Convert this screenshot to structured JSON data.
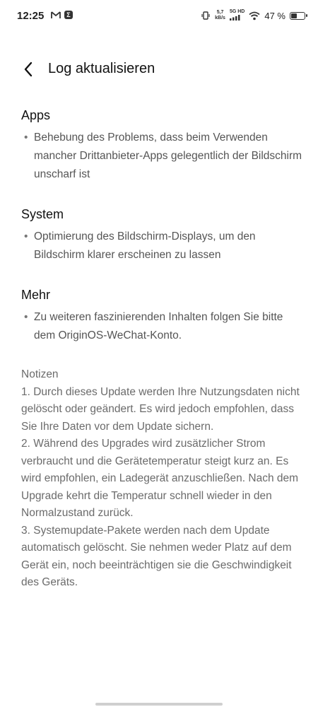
{
  "status_bar": {
    "time": "12:25",
    "left_icons": [
      "mail-icon",
      "app-notification-icon"
    ],
    "speed_value": "5,7",
    "speed_unit": "kB/s",
    "network": "5G HD",
    "battery_percent": "47 %",
    "battery_level": 0.47
  },
  "header": {
    "back_icon": "chevron-left-icon",
    "title": "Log aktualisieren"
  },
  "sections": [
    {
      "title": "Apps",
      "bullets": [
        "Behebung des Problems, dass beim Verwenden mancher Drittanbieter-Apps gelegentlich der Bildschirm unscharf ist"
      ]
    },
    {
      "title": "System",
      "bullets": [
        "Optimierung des Bildschirm-Displays, um den Bildschirm klarer erscheinen zu lassen"
      ]
    },
    {
      "title": "Mehr",
      "bullets": [
        "Zu weiteren faszinierenden Inhalten folgen Sie bitte dem OriginOS-WeChat-Konto."
      ]
    }
  ],
  "notes": {
    "heading": "Notizen",
    "items": [
      "1. Durch dieses Update werden Ihre Nutzungsdaten nicht gelöscht oder geändert. Es wird jedoch empfohlen, dass Sie Ihre Daten vor dem Update sichern.",
      "2. Während des Upgrades wird zusätzlicher Strom verbraucht und die Gerätetemperatur steigt kurz an. Es wird empfohlen, ein Ladegerät anzuschließen. Nach dem Upgrade kehrt die Temperatur schnell wieder in den Normalzustand zurück.",
      "3. Systemupdate-Pakete werden nach dem Update automatisch gelöscht. Sie nehmen weder Platz auf dem Gerät ein, noch beeinträchtigen sie die Geschwindigkeit des Geräts."
    ]
  }
}
